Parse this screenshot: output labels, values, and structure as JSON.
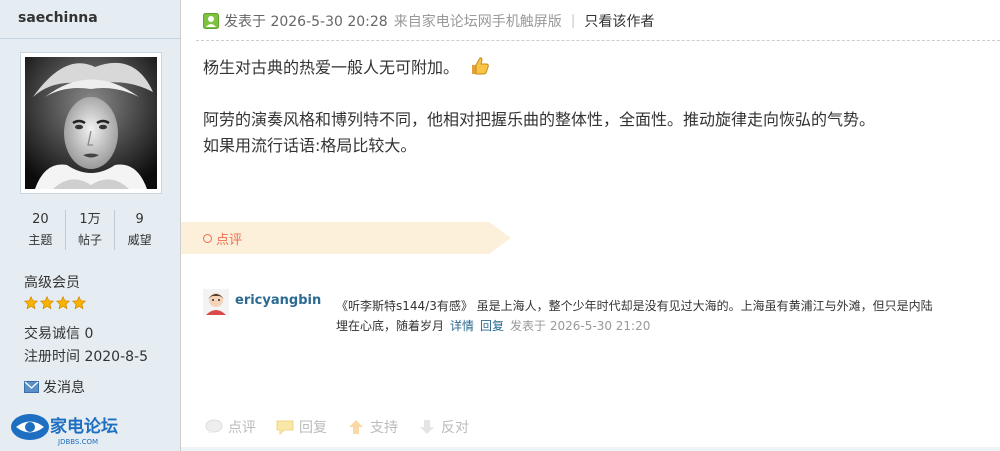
{
  "user": {
    "name": "saechinna",
    "stats": [
      {
        "num": "20",
        "label": "主题"
      },
      {
        "num": "1万",
        "label": "帖子"
      },
      {
        "num": "9",
        "label": "威望"
      }
    ],
    "group": "高级会员",
    "stars": 4,
    "credit": "交易诚信 0",
    "reg": "注册时间 2020-8-5",
    "pm": "发消息"
  },
  "logo": {
    "text": "家电论坛",
    "sub": "JDBBS.COM"
  },
  "post": {
    "posted": "发表于 2026-5-30 20:28",
    "from": "来自家电论坛网手机触屏版",
    "only_author": "只看该作者",
    "lines": [
      "杨生对古典的热爱一般人无可附加。",
      "阿劳的演奏风格和博列特不同，他相对把握乐曲的整体性，全面性。推动旋律走向恢弘的气势。",
      "如果用流行话语:格局比较大。"
    ]
  },
  "rating": {
    "label": "点评"
  },
  "comment": {
    "user": "ericyangbin",
    "text": "《听李斯特s144/3有感》 虽是上海人，整个少年时代却是没有见过大海的。上海虽有黄浦江与外滩，但只是内陆",
    "text2": "埋在心底，随着岁月",
    "detail": "详情",
    "reply": "回复",
    "time": "发表于 2026-5-30 21:20"
  },
  "actions": {
    "rate": "点评",
    "reply": "回复",
    "support": "支持",
    "oppose": "反对"
  },
  "colors": {
    "accent": "#f26c4f",
    "link": "#2b6a91",
    "sidebar": "#e5edf2"
  }
}
